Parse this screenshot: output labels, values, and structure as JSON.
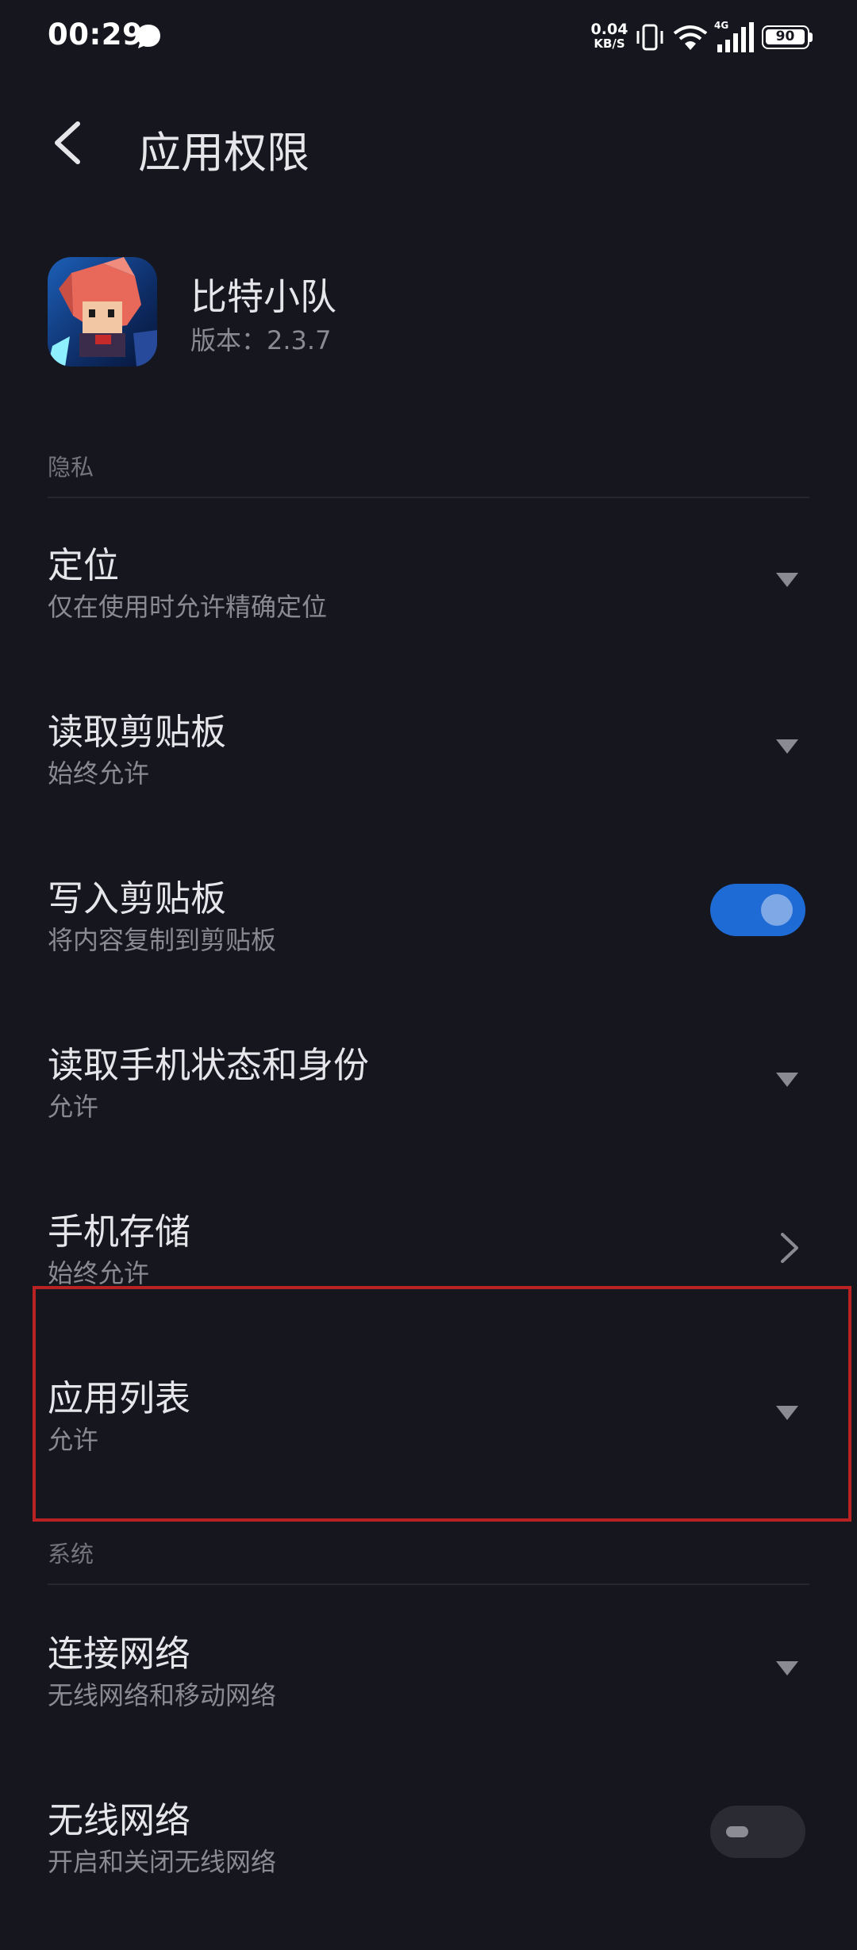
{
  "status_bar": {
    "time": "00:29",
    "net_speed_value": "0.04",
    "net_speed_unit": "KB/S",
    "network_type": "4G",
    "battery": "90",
    "icons": [
      "chat-bubble-icon",
      "vibrate-icon",
      "wifi-icon",
      "signal-icon",
      "battery-icon"
    ]
  },
  "header": {
    "title": "应用权限",
    "back_icon": "back-arrow-icon"
  },
  "app": {
    "name": "比特小队",
    "version": "版本：2.3.7"
  },
  "sections": {
    "privacy": {
      "title": "隐私",
      "items": [
        {
          "title": "定位",
          "subtitle": "仅在使用时允许精确定位",
          "control": "dropdown"
        },
        {
          "title": "读取剪贴板",
          "subtitle": "始终允许",
          "control": "dropdown"
        },
        {
          "title": "写入剪贴板",
          "subtitle": "将内容复制到剪贴板",
          "control": "toggle",
          "toggle_on": true
        },
        {
          "title": "读取手机状态和身份",
          "subtitle": "允许",
          "control": "dropdown"
        },
        {
          "title": "手机存储",
          "subtitle": "始终允许",
          "control": "chevron"
        },
        {
          "title": "应用列表",
          "subtitle": "允许",
          "control": "dropdown"
        }
      ]
    },
    "system": {
      "title": "系统",
      "items": [
        {
          "title": "连接网络",
          "subtitle": "无线网络和移动网络",
          "control": "dropdown"
        },
        {
          "title": "无线网络",
          "subtitle": "开启和关闭无线网络",
          "control": "toggle",
          "toggle_on": false
        }
      ]
    }
  },
  "colors": {
    "background": "#15161e",
    "toggle_on": "#1e6bd6",
    "toggle_off": "#2b2c33",
    "highlight": "#b82222"
  }
}
